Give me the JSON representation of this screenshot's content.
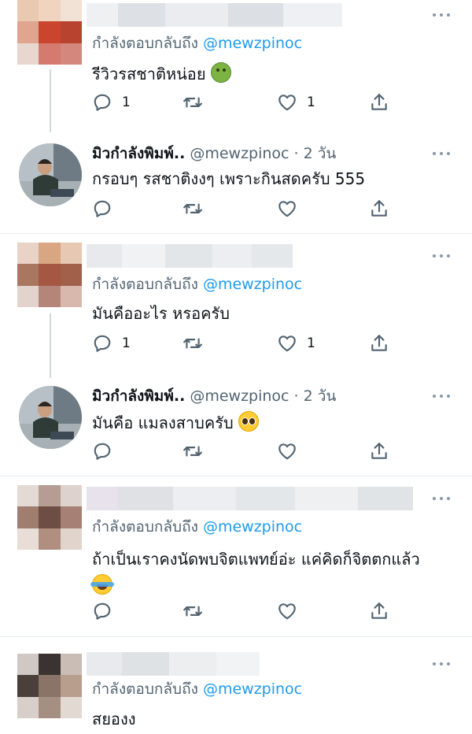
{
  "colors": {
    "accent": "#1d9bf0",
    "muted": "#536471",
    "text": "#0f1419",
    "divider": "#e6ecf0"
  },
  "icons": {
    "reply": "reply-icon",
    "retweet": "retweet-icon",
    "like": "heart-icon",
    "share": "share-icon",
    "more": "more-icon"
  },
  "tweets": [
    {
      "reply_prefix": "กำลังตอบกลับถึง",
      "reply_handle": "@mewzpinoc",
      "text": "รีวิวรสชาติหน่อย",
      "replies": "1",
      "likes": "1"
    },
    {
      "user_name": "มิวกำลังพิมพ์..",
      "handle_time": "@mewzpinoc · 2 วัน",
      "text": "กรอบๆ รสชาติงงๆ เพราะกินสดครับ 555"
    },
    {
      "reply_prefix": "กำลังตอบกลับถึง",
      "reply_handle": "@mewzpinoc",
      "text": "มันคืออะไร หรอครับ",
      "replies": "1",
      "likes": "1"
    },
    {
      "user_name": "มิวกำลังพิมพ์..",
      "handle_time": "@mewzpinoc · 2 วัน",
      "text": "มันคือ แมลงสาบครับ"
    },
    {
      "reply_prefix": "กำลังตอบกลับถึง",
      "reply_handle": "@mewzpinoc",
      "text": "ถ้าเป็นเราคงนัดพบจิตแพทย์อ่ะ แค่คิดก็จิตตกแล้ว"
    },
    {
      "reply_prefix": "กำลังตอบกลับถึง",
      "reply_handle": "@mewzpinoc",
      "text": "สยองง"
    }
  ]
}
